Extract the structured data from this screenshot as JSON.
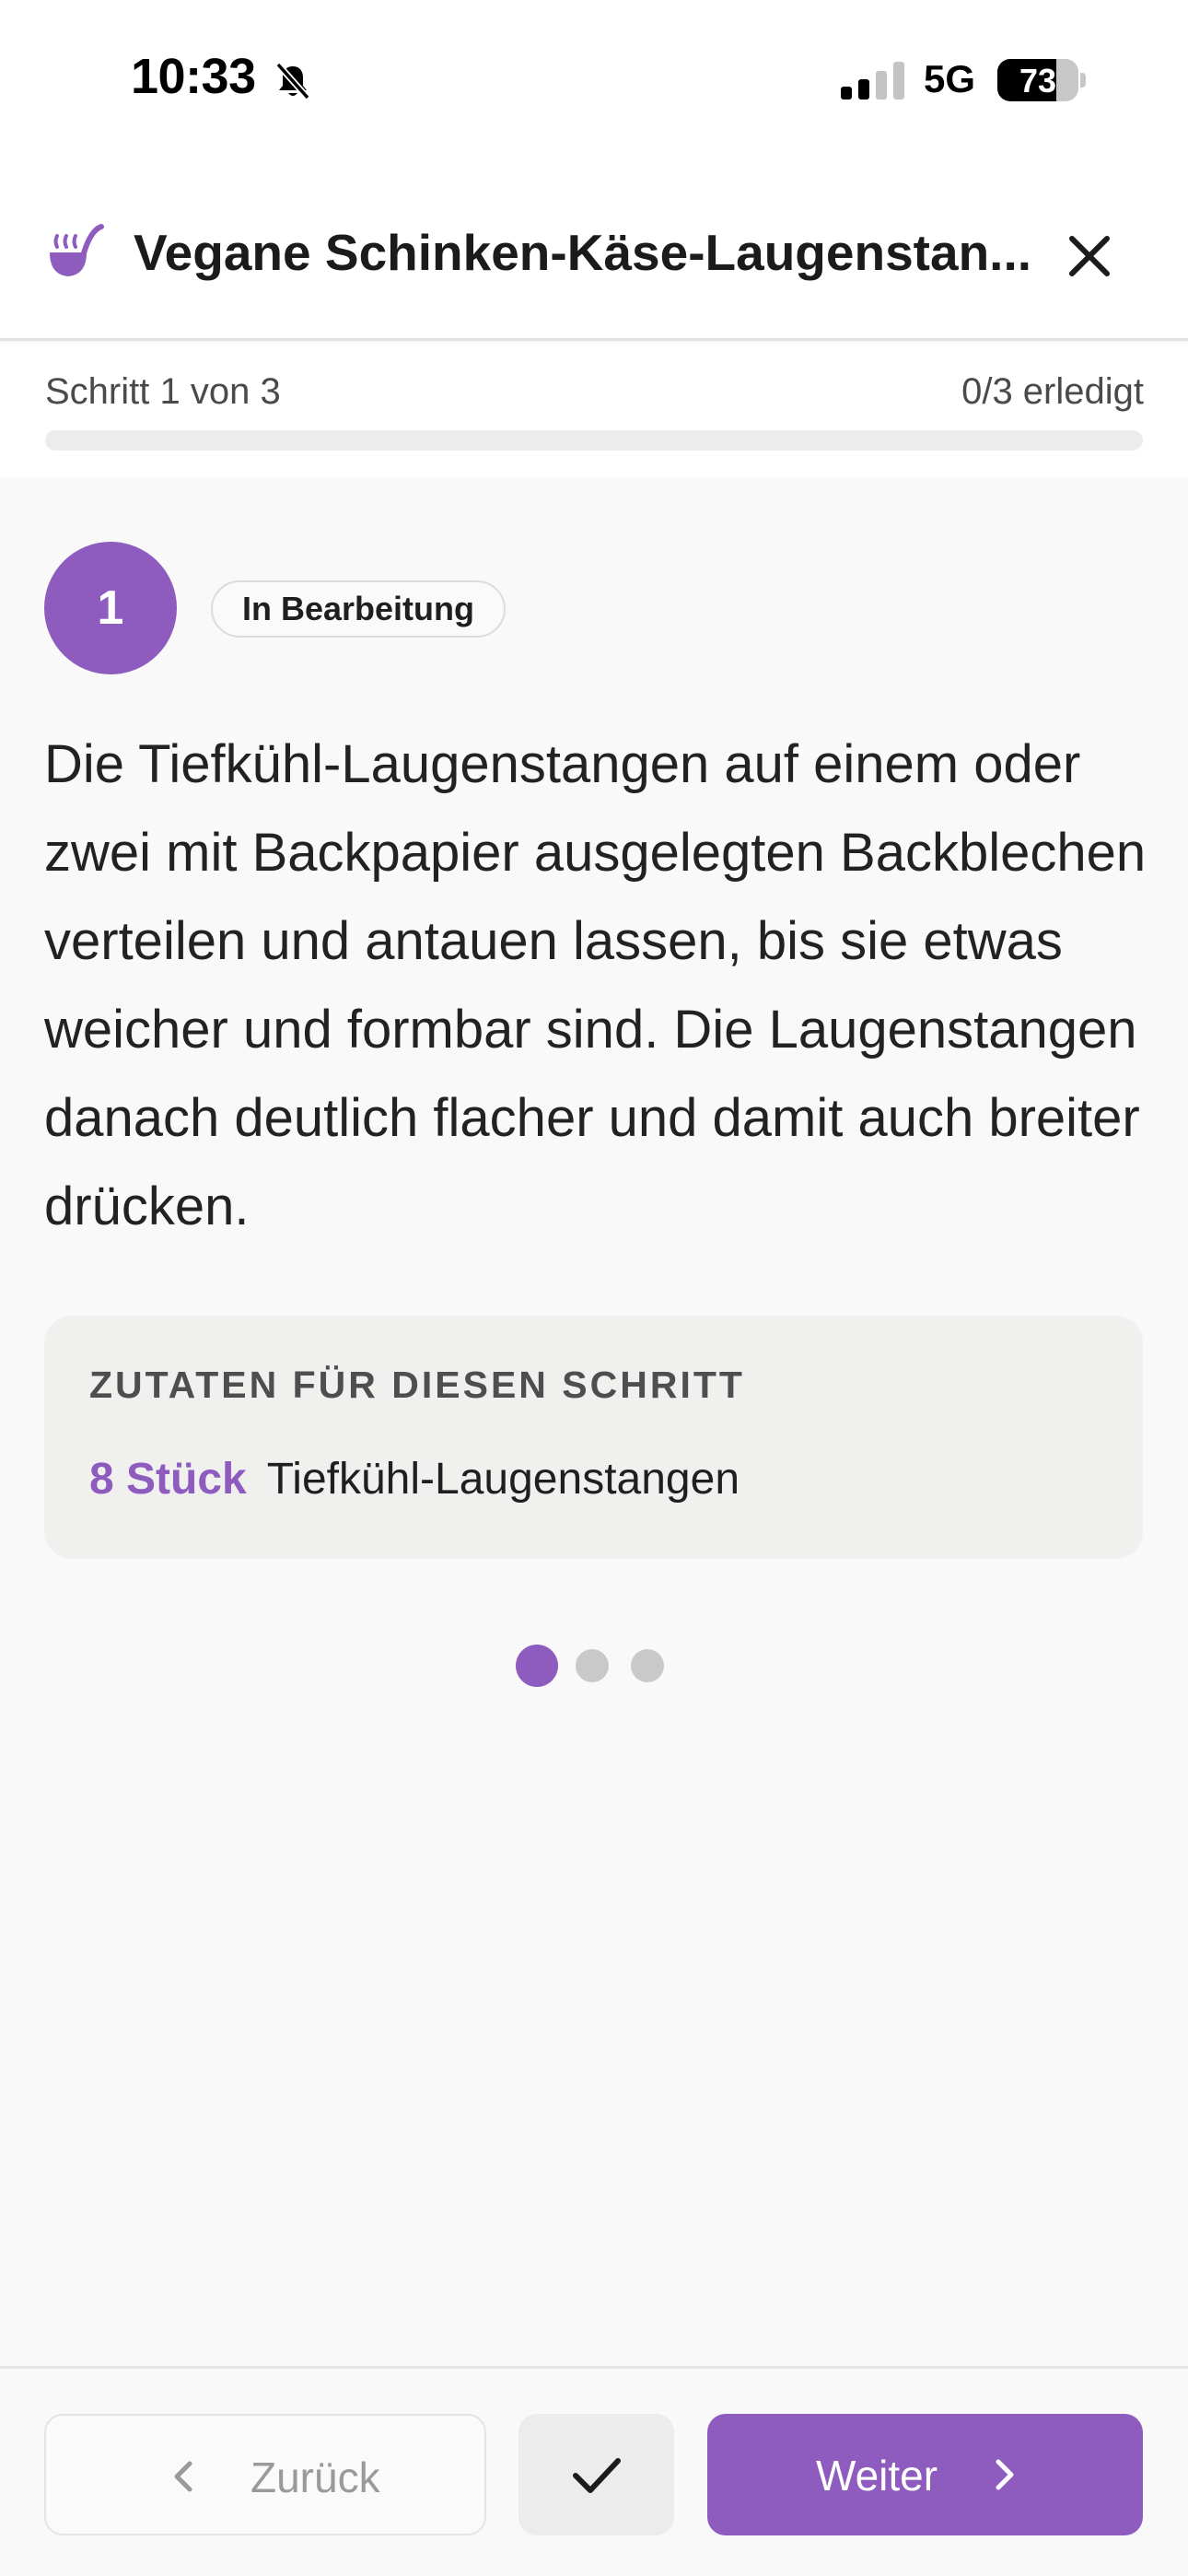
{
  "status_bar": {
    "time": "10:33",
    "network": "5G",
    "battery_level": "73",
    "battery_fraction": 0.73
  },
  "header": {
    "title": "Vegane Schinken-Käse-Laugenstan...",
    "icon": "ladle-pot-icon",
    "close_icon": "close-icon"
  },
  "progress": {
    "step_label": "Schritt 1 von 3",
    "done_label": "0/3 erledigt",
    "fraction": 0
  },
  "step": {
    "number": "1",
    "status": "In Bearbeitung",
    "text": "Die Tiefkühl-Laugenstangen auf einem oder zwei mit Backpapier ausgelegten Backblechen verteilen und antauen lassen, bis sie etwas weicher und formbar sind. Die Laugenstangen danach deutlich flacher und damit auch breiter drücken."
  },
  "ingredients": {
    "title": "ZUTATEN FÜR DIESEN SCHRITT",
    "items": [
      {
        "quantity": "8 Stück",
        "name": "Tiefkühl-Laugenstangen"
      }
    ]
  },
  "pager": {
    "total": 3,
    "active": 0
  },
  "footer": {
    "back_label": "Zurück",
    "next_label": "Weiter",
    "check_icon": "check-icon"
  },
  "colors": {
    "accent": "#8e5bbf",
    "dot_inactive": "#c9c9c9",
    "background": "#f9f9f9"
  }
}
